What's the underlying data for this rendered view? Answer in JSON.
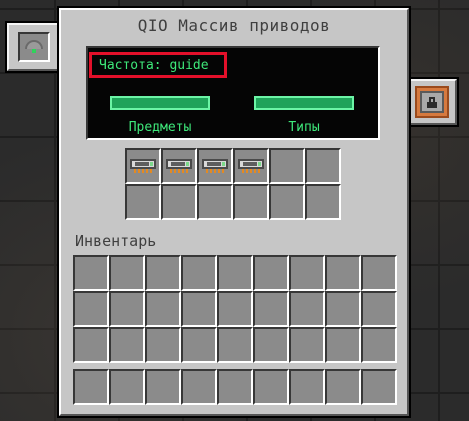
{
  "window": {
    "title": "QIO Массив приводов"
  },
  "display": {
    "frequency": "Частота: guide",
    "items_label": "Предметы",
    "types_label": "Типы",
    "colors": {
      "text": "#3ee87a",
      "highlight_border": "#e3102a",
      "bar_fill": "#1fa35a"
    }
  },
  "drive_slots": [
    {
      "item": "drive-icon"
    },
    {
      "item": "drive-icon"
    },
    {
      "item": "drive-icon"
    },
    {
      "item": "drive-icon"
    },
    {
      "item": null
    },
    {
      "item": null
    },
    {
      "item": null
    },
    {
      "item": null
    },
    {
      "item": null
    },
    {
      "item": null
    },
    {
      "item": null
    },
    {
      "item": null
    }
  ],
  "inventory": {
    "label": "Инвентарь"
  },
  "side_buttons": {
    "left": {
      "icon": "redstone-control-icon"
    },
    "right": {
      "icon": "lock-icon"
    }
  }
}
